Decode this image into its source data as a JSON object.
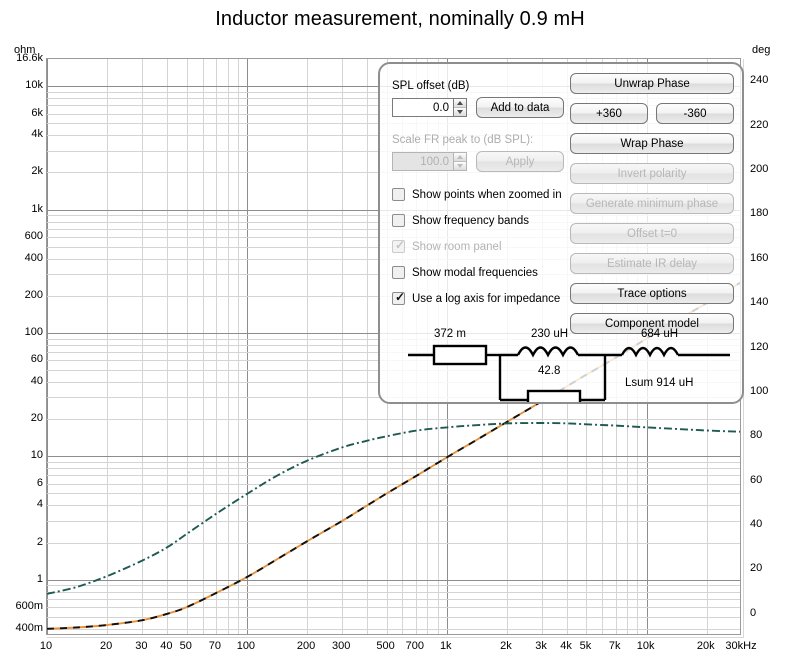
{
  "chart_data": {
    "type": "line",
    "title": "Inductor measurement, nominally 0.9 mH",
    "xlabel": "",
    "ylabel": "ohm",
    "y2label": "deg",
    "xscale": "log",
    "yscale": "log",
    "xlim": [
      10,
      30000
    ],
    "ylim": [
      0.35,
      16600
    ],
    "y2lim": [
      -10,
      250
    ],
    "grid": true,
    "legend": "none",
    "x_ticks": [
      "10",
      "20",
      "30",
      "40",
      "50",
      "70",
      "100",
      "200",
      "300",
      "500",
      "700",
      "1k",
      "2k",
      "3k",
      "4k",
      "5k",
      "7k",
      "10k",
      "20k",
      "30kHz"
    ],
    "y_ticks": [
      "16.6k",
      "10k",
      "6k",
      "4k",
      "2k",
      "1k",
      "600",
      "400",
      "200",
      "100",
      "60",
      "40",
      "20",
      "10",
      "6",
      "4",
      "2",
      "1",
      "600m",
      "400m"
    ],
    "y2_ticks": [
      "240",
      "220",
      "200",
      "180",
      "160",
      "140",
      "120",
      "100",
      "80",
      "60",
      "40",
      "20",
      "0"
    ],
    "series": [
      {
        "name": "impedance",
        "axis": "left",
        "units": "ohm",
        "color": "#e8903a",
        "style": "solid",
        "points": [
          [
            10,
            0.4
          ],
          [
            14,
            0.41
          ],
          [
            20,
            0.43
          ],
          [
            30,
            0.47
          ],
          [
            40,
            0.53
          ],
          [
            50,
            0.6
          ],
          [
            70,
            0.78
          ],
          [
            100,
            1.05
          ],
          [
            140,
            1.45
          ],
          [
            200,
            2.05
          ],
          [
            300,
            3.0
          ],
          [
            400,
            4.0
          ],
          [
            500,
            5.0
          ],
          [
            700,
            6.9
          ],
          [
            1000,
            9.8
          ],
          [
            1400,
            13.5
          ],
          [
            2000,
            19
          ],
          [
            3000,
            28
          ],
          [
            4000,
            37
          ],
          [
            5000,
            46
          ],
          [
            7000,
            63
          ],
          [
            10000,
            90
          ],
          [
            14000,
            125
          ],
          [
            20000,
            175
          ],
          [
            30000,
            260
          ]
        ]
      },
      {
        "name": "impedance model",
        "axis": "left",
        "units": "ohm",
        "color": "#111111",
        "style": "dashed",
        "points": [
          [
            10,
            0.4
          ],
          [
            14,
            0.41
          ],
          [
            20,
            0.43
          ],
          [
            30,
            0.47
          ],
          [
            40,
            0.53
          ],
          [
            50,
            0.6
          ],
          [
            70,
            0.78
          ],
          [
            100,
            1.05
          ],
          [
            140,
            1.45
          ],
          [
            200,
            2.05
          ],
          [
            300,
            3.0
          ],
          [
            400,
            4.0
          ],
          [
            500,
            5.0
          ],
          [
            700,
            6.9
          ],
          [
            1000,
            9.8
          ],
          [
            1400,
            13.5
          ],
          [
            2000,
            19
          ],
          [
            3000,
            28
          ],
          [
            4000,
            37
          ],
          [
            5000,
            46
          ],
          [
            7000,
            63
          ],
          [
            10000,
            90
          ],
          [
            14000,
            125
          ],
          [
            20000,
            175
          ],
          [
            30000,
            260
          ]
        ]
      },
      {
        "name": "phase",
        "axis": "right",
        "units": "deg",
        "color": "#1f5a52",
        "style": "dash-dot",
        "points": [
          [
            10,
            9
          ],
          [
            14,
            12
          ],
          [
            20,
            17
          ],
          [
            30,
            24
          ],
          [
            40,
            30
          ],
          [
            50,
            36
          ],
          [
            70,
            45
          ],
          [
            100,
            54
          ],
          [
            140,
            62
          ],
          [
            200,
            69
          ],
          [
            300,
            75
          ],
          [
            400,
            78
          ],
          [
            500,
            80
          ],
          [
            700,
            82.5
          ],
          [
            1000,
            84
          ],
          [
            1400,
            85
          ],
          [
            2000,
            85.8
          ],
          [
            3000,
            86
          ],
          [
            4000,
            85.8
          ],
          [
            5000,
            85.4
          ],
          [
            7000,
            84.8
          ],
          [
            10000,
            84
          ],
          [
            14000,
            83.3
          ],
          [
            20000,
            82.6
          ],
          [
            30000,
            82
          ]
        ]
      }
    ]
  },
  "axes": {
    "left_unit": "ohm",
    "right_unit": "deg"
  },
  "panel": {
    "spl_offset_label": "SPL offset (dB)",
    "spl_offset_value": "0.0",
    "add_to_data_label": "Add to data",
    "scale_fr_label": "Scale FR peak to (dB SPL):",
    "scale_fr_value": "100.0",
    "apply_label": "Apply",
    "checkboxes": [
      {
        "label": "Show points when zoomed in",
        "checked": false,
        "enabled": true
      },
      {
        "label": "Show frequency bands",
        "checked": false,
        "enabled": true
      },
      {
        "label": "Show room panel",
        "checked": true,
        "enabled": false
      },
      {
        "label": "Show modal frequencies",
        "checked": false,
        "enabled": true
      },
      {
        "label": "Use a log axis for impedance",
        "checked": true,
        "enabled": true
      }
    ],
    "buttons": [
      {
        "label": "Unwrap Phase",
        "enabled": true
      },
      {
        "label": "+360",
        "enabled": true
      },
      {
        "label": "-360",
        "enabled": true
      },
      {
        "label": "Wrap Phase",
        "enabled": true
      },
      {
        "label": "Invert polarity",
        "enabled": false
      },
      {
        "label": "Generate minimum phase",
        "enabled": false
      },
      {
        "label": "Offset t=0",
        "enabled": false
      },
      {
        "label": "Estimate IR delay",
        "enabled": false
      },
      {
        "label": "Trace options",
        "enabled": true
      },
      {
        "label": "Component model",
        "enabled": true
      }
    ]
  },
  "circuit": {
    "series_resistance": "372 m",
    "parallel_inductance": "230 uH",
    "parallel_resistance": "42.8",
    "series_inductance": "684 uH",
    "total_label": "Lsum 914 uH"
  }
}
